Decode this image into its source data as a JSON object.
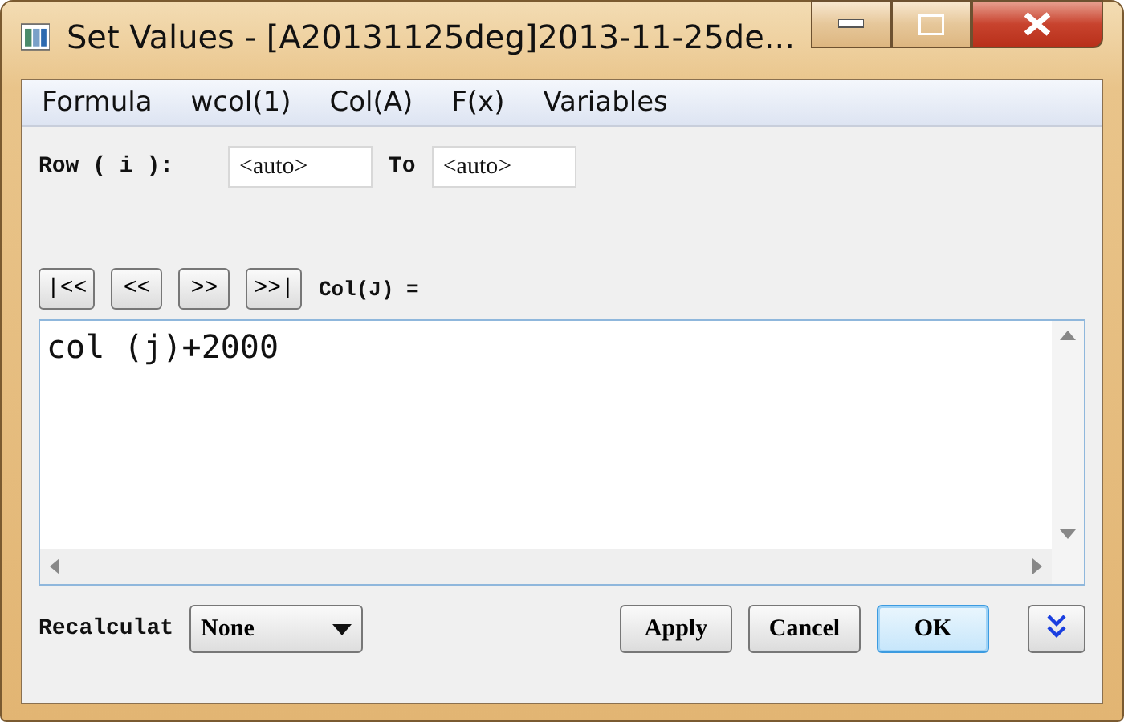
{
  "window": {
    "title": "Set Values - [A20131125deg]2013-11-25de..."
  },
  "menu": [
    "Formula",
    "wcol(1)",
    "Col(A)",
    "F(x)",
    "Variables"
  ],
  "row_range": {
    "label": "Row ( i ):",
    "from": "<auto>",
    "to_label": "To",
    "to": "<auto>"
  },
  "nav_buttons": [
    "|<<",
    "<<",
    ">>",
    ">>|"
  ],
  "column_label": "Col(J) =",
  "formula": "col (j)+2000",
  "recalculate": {
    "label": "Recalculat",
    "value": "None"
  },
  "buttons": [
    {
      "label": "Apply",
      "default": false
    },
    {
      "label": "Cancel",
      "default": false
    },
    {
      "label": "OK",
      "default": true
    }
  ]
}
